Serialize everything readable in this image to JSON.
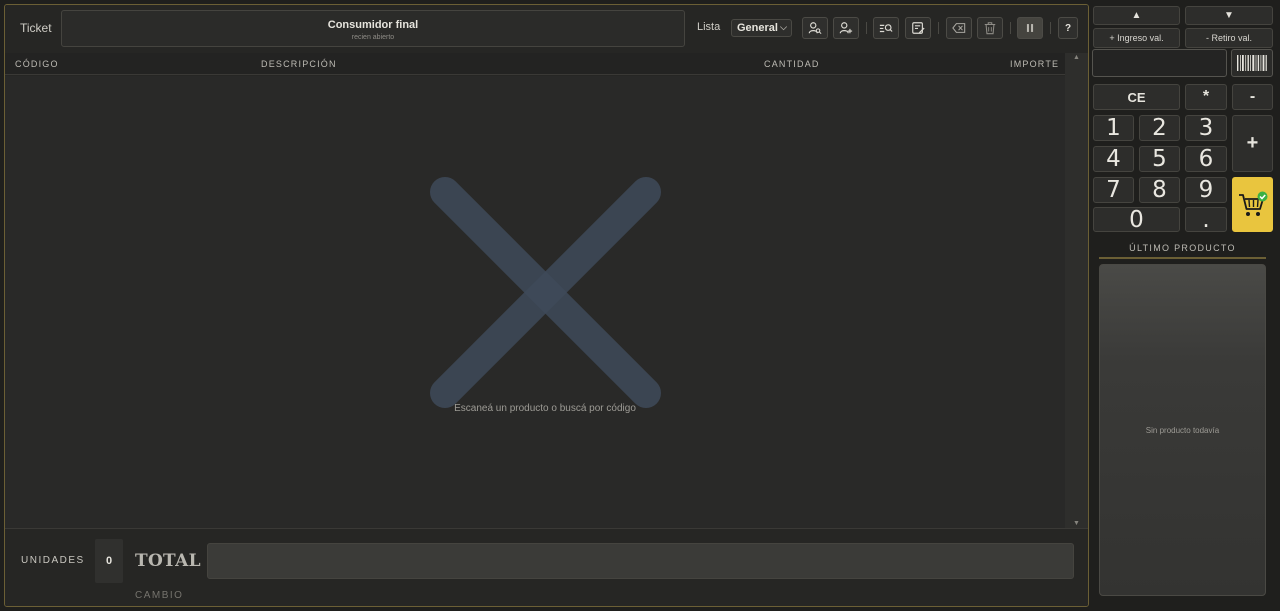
{
  "header": {
    "ticket_label": "Ticket",
    "customer_name": "Consumidor final",
    "customer_status": "recien abierto",
    "list_label": "Lista",
    "list_value": "General",
    "help_label": "?"
  },
  "toolbar_icons": [
    "search-customer-icon",
    "add-customer-icon",
    "search-product-icon",
    "edit-ticket-icon",
    "backspace-icon",
    "trash-icon",
    "pause-icon",
    "help-icon"
  ],
  "table": {
    "columns": [
      "CÓDIGO",
      "DESCRIPCIÓN",
      "CANTIDAD",
      "IMPORTE"
    ],
    "rows": [],
    "empty_message": "Escaneá un producto o buscá por código"
  },
  "footer": {
    "units_label": "UNIDADES",
    "units_value": "0",
    "total_label": "TOTAL",
    "total_value": "",
    "change_label": "CAMBIO"
  },
  "right_panel": {
    "up_label": "▲",
    "down_label": "▼",
    "cash_in_label": "+ Ingreso val.",
    "cash_out_label": "- Retiro val.",
    "scan_value": "",
    "keypad": {
      "ce": "CE",
      "multiply": "*",
      "minus": "-",
      "plus": "+",
      "one": "1",
      "two": "2",
      "three": "3",
      "four": "4",
      "five": "5",
      "six": "6",
      "seven": "7",
      "eight": "8",
      "nine": "9",
      "zero": "0",
      "dot": "."
    },
    "last_product_title": "ÚLTIMO PRODUCTO",
    "last_product_empty": "Sin producto todavía"
  },
  "colors": {
    "accent": "#e9c53e",
    "border_accent": "#6b5f35",
    "background": "#1f1f1d",
    "panel": "#262624",
    "empty_art": "#3f4a5a",
    "cart_check": "#3cb043"
  }
}
